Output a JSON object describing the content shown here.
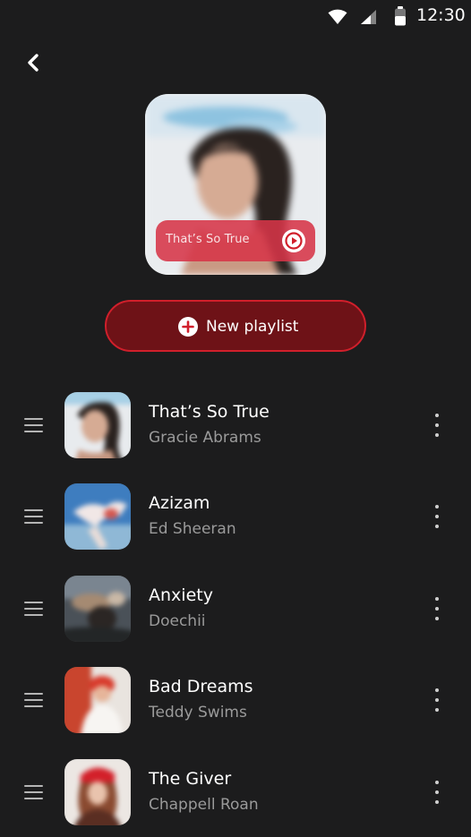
{
  "status_bar": {
    "time": "12:30",
    "icons": [
      "wifi-icon",
      "cell-signal-icon",
      "battery-icon"
    ]
  },
  "header": {
    "back_icon": "chevron-left-icon"
  },
  "cover": {
    "title": "That’s So True",
    "play_icon": "play-circle-icon",
    "pill_color": "#d63448"
  },
  "actions": {
    "new_playlist_label": "New playlist",
    "new_playlist_icon": "plus-circle-icon",
    "accent": "#d11f2b",
    "button_fill": "#6e1217"
  },
  "songs": [
    {
      "title": "That’s So True",
      "artist": "Gracie Abrams"
    },
    {
      "title": "Azizam",
      "artist": "Ed Sheeran"
    },
    {
      "title": "Anxiety",
      "artist": "Doechii"
    },
    {
      "title": "Bad Dreams",
      "artist": "Teddy Swims"
    },
    {
      "title": "The Giver",
      "artist": "Chappell Roan"
    }
  ],
  "theme": {
    "background": "#1c1c1d",
    "secondary_text": "#9a9a9a"
  }
}
